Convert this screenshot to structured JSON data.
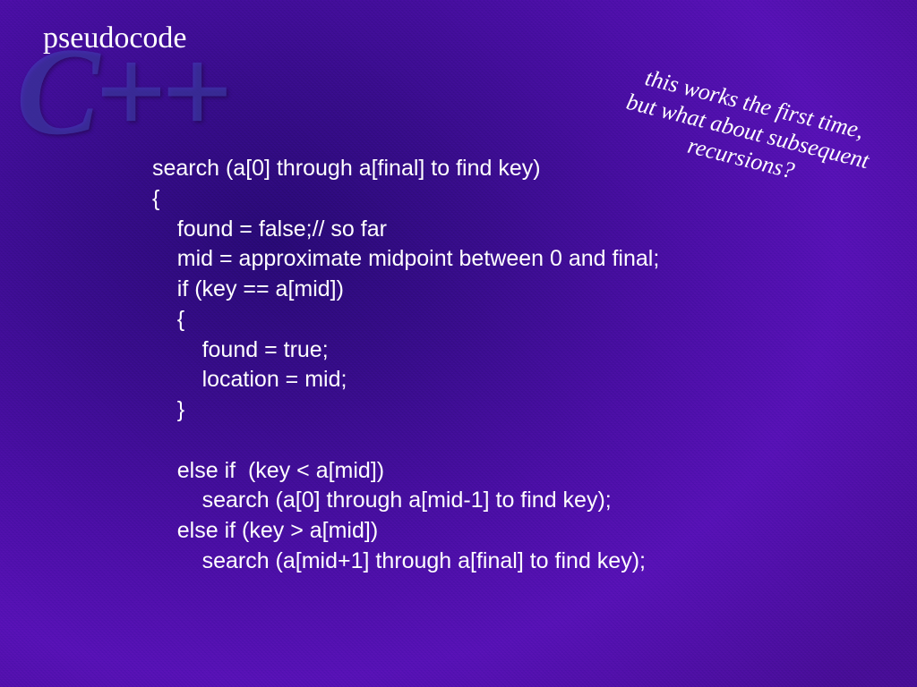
{
  "watermark": "C++",
  "title": "pseudocode",
  "note": "this works the first time,\nbut what about subsequent\nrecursions?",
  "code": "search (a[0] through a[final] to find key)\n{\n    found = false;// so far\n    mid = approximate midpoint between 0 and final;\n    if (key == a[mid])\n    {\n        found = true;\n        location = mid;\n    }\n\n    else if  (key < a[mid])\n        search (a[0] through a[mid-1] to find key);\n    else if (key > a[mid])\n        search (a[mid+1] through a[final] to find key);"
}
